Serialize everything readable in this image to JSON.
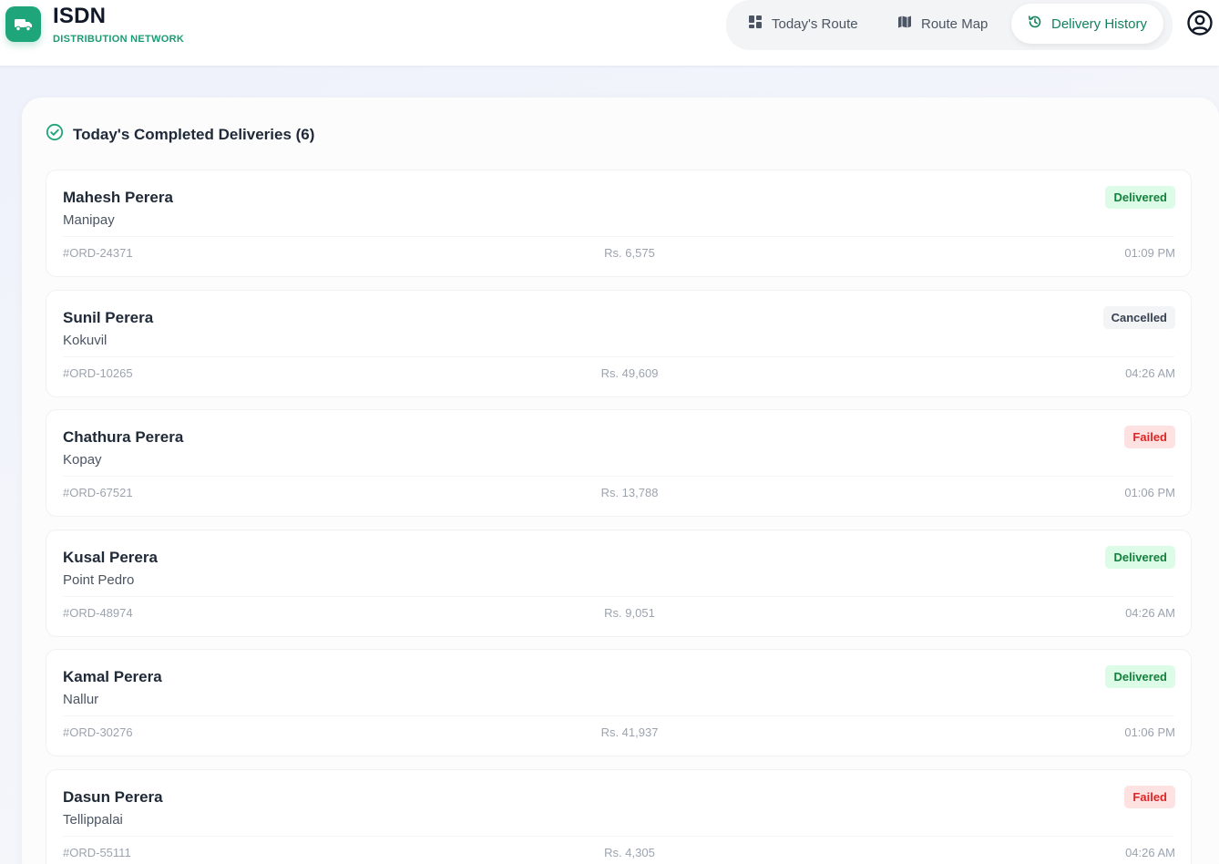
{
  "brand": {
    "title": "ISDN",
    "subtitle": "DISTRIBUTION NETWORK",
    "icon": "truck-icon",
    "accent": "#1fa57a"
  },
  "nav": {
    "items": [
      {
        "label": "Today's Route",
        "icon": "dashboard-grid-icon",
        "active": false
      },
      {
        "label": "Route Map",
        "icon": "map-icon",
        "active": false
      },
      {
        "label": "Delivery History",
        "icon": "history-icon",
        "active": true
      }
    ],
    "profile_icon": "user-circle-icon"
  },
  "section": {
    "title": "Today's Completed Deliveries (6)",
    "icon": "check-circle-icon"
  },
  "deliveries": [
    {
      "name": "Mahesh Perera",
      "location": "Manipay",
      "status": "Delivered",
      "status_type": "delivered",
      "order_id": "#ORD-24371",
      "amount": "Rs. 6,575",
      "time": "01:09 PM"
    },
    {
      "name": "Sunil Perera",
      "location": "Kokuvil",
      "status": "Cancelled",
      "status_type": "cancelled",
      "order_id": "#ORD-10265",
      "amount": "Rs. 49,609",
      "time": "04:26 AM"
    },
    {
      "name": "Chathura Perera",
      "location": "Kopay",
      "status": "Failed",
      "status_type": "failed",
      "order_id": "#ORD-67521",
      "amount": "Rs. 13,788",
      "time": "01:06 PM"
    },
    {
      "name": "Kusal Perera",
      "location": "Point Pedro",
      "status": "Delivered",
      "status_type": "delivered",
      "order_id": "#ORD-48974",
      "amount": "Rs. 9,051",
      "time": "04:26 AM"
    },
    {
      "name": "Kamal Perera",
      "location": "Nallur",
      "status": "Delivered",
      "status_type": "delivered",
      "order_id": "#ORD-30276",
      "amount": "Rs. 41,937",
      "time": "01:06 PM"
    },
    {
      "name": "Dasun Perera",
      "location": "Tellippalai",
      "status": "Failed",
      "status_type": "failed",
      "order_id": "#ORD-55111",
      "amount": "Rs. 4,305",
      "time": "04:26 AM"
    }
  ],
  "colors": {
    "delivered": "#15803d",
    "cancelled": "#374151",
    "failed": "#dc2626"
  }
}
